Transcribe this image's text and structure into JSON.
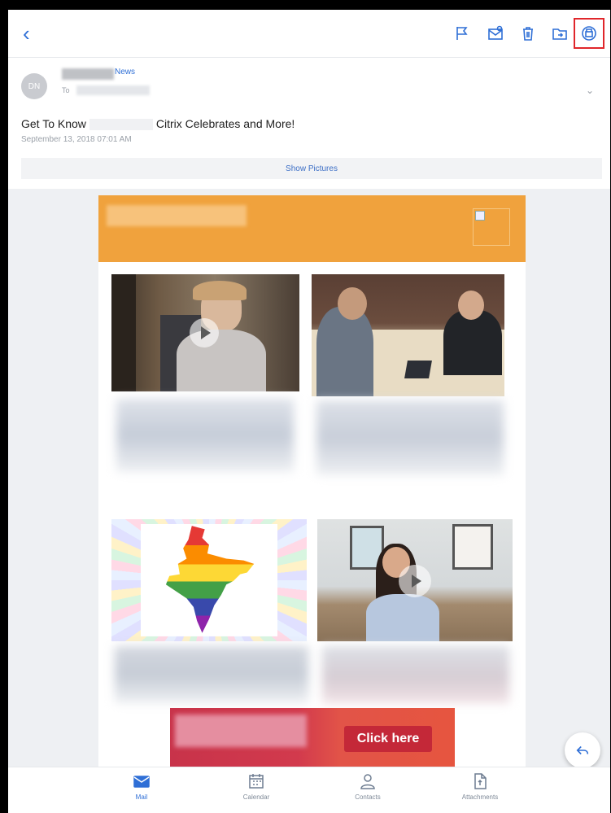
{
  "toolbar": {
    "back_icon": "back-chevron-icon",
    "icons": [
      "flag-icon",
      "mark-unread-icon",
      "trash-icon",
      "move-folder-icon",
      "print-icon"
    ]
  },
  "header": {
    "avatar_initials": "DN",
    "sender_name_suffix": "News",
    "to_label": "To",
    "subject_prefix": "Get To Know",
    "subject_suffix": "Citrix Celebrates and More!",
    "date": "September 13, 2018 07:01 AM",
    "show_pictures": "Show Pictures"
  },
  "email": {
    "banner_color": "#f0a23d",
    "cta_label": "Click here",
    "cta_color": "#c42838"
  },
  "tabs": [
    {
      "label": "Mail",
      "icon": "mail-icon",
      "active": true
    },
    {
      "label": "Calendar",
      "icon": "calendar-icon",
      "active": false
    },
    {
      "label": "Contacts",
      "icon": "contacts-icon",
      "active": false
    },
    {
      "label": "Attachments",
      "icon": "attachments-icon",
      "active": false
    }
  ]
}
